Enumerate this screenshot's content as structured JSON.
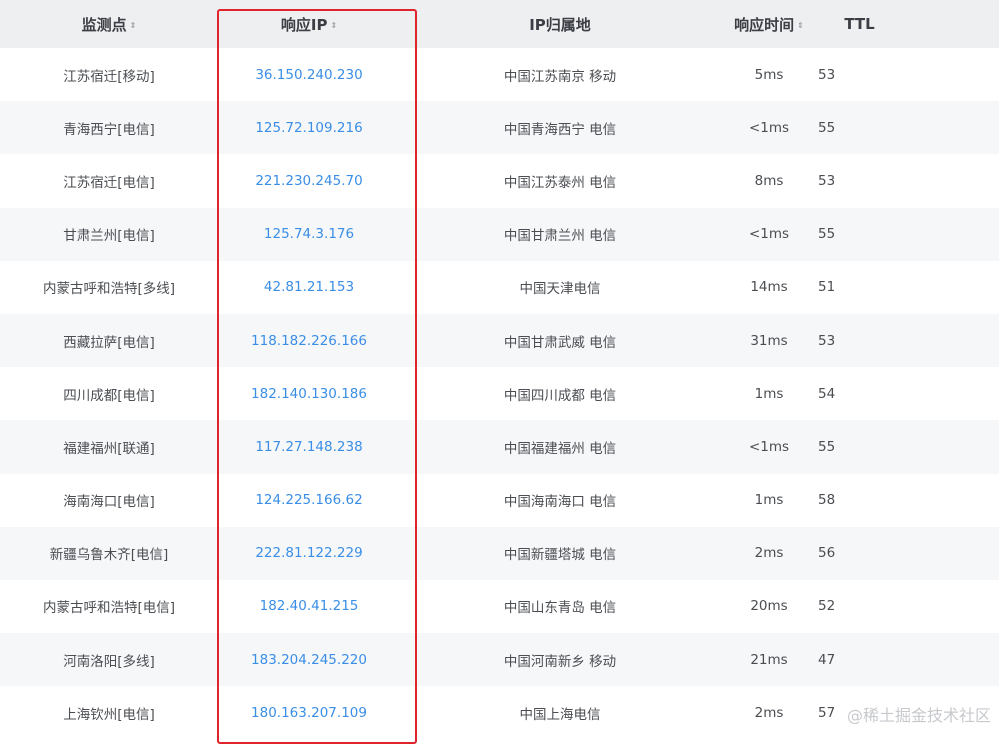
{
  "table": {
    "headers": {
      "monitor": "监测点",
      "ip": "响应IP",
      "location": "IP归属地",
      "time": "响应时间",
      "ttl": "TTL"
    },
    "sort_icon": "⇕",
    "rows": [
      {
        "monitor": "江苏宿迁[移动]",
        "ip": "36.150.240.230",
        "location": "中国江苏南京 移动",
        "time": "5ms",
        "ttl": "53"
      },
      {
        "monitor": "青海西宁[电信]",
        "ip": "125.72.109.216",
        "location": "中国青海西宁 电信",
        "time": "<1ms",
        "ttl": "55"
      },
      {
        "monitor": "江苏宿迁[电信]",
        "ip": "221.230.245.70",
        "location": "中国江苏泰州 电信",
        "time": "8ms",
        "ttl": "53"
      },
      {
        "monitor": "甘肃兰州[电信]",
        "ip": "125.74.3.176",
        "location": "中国甘肃兰州 电信",
        "time": "<1ms",
        "ttl": "55"
      },
      {
        "monitor": "内蒙古呼和浩特[多线]",
        "ip": "42.81.21.153",
        "location": "中国天津电信",
        "time": "14ms",
        "ttl": "51"
      },
      {
        "monitor": "西藏拉萨[电信]",
        "ip": "118.182.226.166",
        "location": "中国甘肃武威 电信",
        "time": "31ms",
        "ttl": "53"
      },
      {
        "monitor": "四川成都[电信]",
        "ip": "182.140.130.186",
        "location": "中国四川成都 电信",
        "time": "1ms",
        "ttl": "54"
      },
      {
        "monitor": "福建福州[联通]",
        "ip": "117.27.148.238",
        "location": "中国福建福州 电信",
        "time": "<1ms",
        "ttl": "55"
      },
      {
        "monitor": "海南海口[电信]",
        "ip": "124.225.166.62",
        "location": "中国海南海口 电信",
        "time": "1ms",
        "ttl": "58"
      },
      {
        "monitor": "新疆乌鲁木齐[电信]",
        "ip": "222.81.122.229",
        "location": "中国新疆塔城 电信",
        "time": "2ms",
        "ttl": "56"
      },
      {
        "monitor": "内蒙古呼和浩特[电信]",
        "ip": "182.40.41.215",
        "location": "中国山东青岛 电信",
        "time": "20ms",
        "ttl": "52"
      },
      {
        "monitor": "河南洛阳[多线]",
        "ip": "183.204.245.220",
        "location": "中国河南新乡 移动",
        "time": "21ms",
        "ttl": "47"
      },
      {
        "monitor": "上海钦州[电信]",
        "ip": "180.163.207.109",
        "location": "中国上海电信",
        "time": "2ms",
        "ttl": "57"
      }
    ]
  },
  "watermark": "@稀土掘金技术社区"
}
